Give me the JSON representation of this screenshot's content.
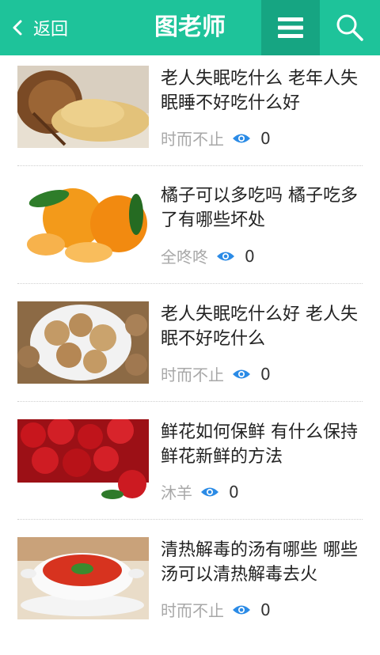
{
  "header": {
    "back_label": "返回",
    "title": "图老师",
    "accent_color": "#1ec39a"
  },
  "articles": [
    {
      "title": "老人失眠吃什么 老年人失眠睡不好吃什么好",
      "author": "时而不止",
      "views": "0",
      "image": "grain-in-pot"
    },
    {
      "title": "橘子可以多吃吗 橘子吃多了有哪些坏处",
      "author": "全咚咚",
      "views": "0",
      "image": "oranges"
    },
    {
      "title": "老人失眠吃什么好 老人失眠不好吃什么",
      "author": "时而不止",
      "views": "0",
      "image": "walnuts"
    },
    {
      "title": "鲜花如何保鲜 有什么保持鲜花新鲜的方法",
      "author": "沐羊",
      "views": "0",
      "image": "red-roses"
    },
    {
      "title": "清热解毒的汤有哪些 哪些汤可以清热解毒去火",
      "author": "时而不止",
      "views": "0",
      "image": "tomato-soup"
    }
  ]
}
